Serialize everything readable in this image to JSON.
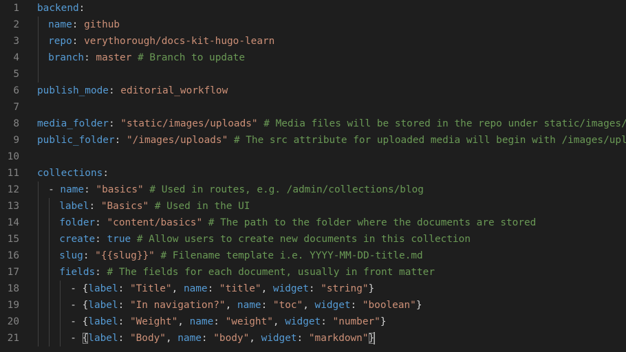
{
  "editor": {
    "lines": [
      {
        "n": "1",
        "indent": 0,
        "guides": [],
        "tokens": [
          {
            "t": "key",
            "v": "backend"
          },
          {
            "t": "pun",
            "v": ":"
          }
        ]
      },
      {
        "n": "2",
        "indent": 2,
        "guides": [
          0
        ],
        "tokens": [
          {
            "t": "key",
            "v": "name"
          },
          {
            "t": "pun",
            "v": ": "
          },
          {
            "t": "str",
            "v": "github"
          }
        ]
      },
      {
        "n": "3",
        "indent": 2,
        "guides": [
          0
        ],
        "tokens": [
          {
            "t": "key",
            "v": "repo"
          },
          {
            "t": "pun",
            "v": ": "
          },
          {
            "t": "str",
            "v": "verythorough/docs-kit-hugo-learn"
          }
        ]
      },
      {
        "n": "4",
        "indent": 2,
        "guides": [
          0
        ],
        "tokens": [
          {
            "t": "key",
            "v": "branch"
          },
          {
            "t": "pun",
            "v": ": "
          },
          {
            "t": "str",
            "v": "master"
          },
          {
            "t": "pun",
            "v": " "
          },
          {
            "t": "com",
            "v": "# Branch to update"
          }
        ]
      },
      {
        "n": "5",
        "indent": 0,
        "guides": [
          0
        ],
        "tokens": []
      },
      {
        "n": "6",
        "indent": 0,
        "guides": [],
        "tokens": [
          {
            "t": "key",
            "v": "publish_mode"
          },
          {
            "t": "pun",
            "v": ": "
          },
          {
            "t": "str",
            "v": "editorial_workflow"
          }
        ]
      },
      {
        "n": "7",
        "indent": 0,
        "guides": [],
        "tokens": []
      },
      {
        "n": "8",
        "indent": 0,
        "guides": [],
        "tokens": [
          {
            "t": "key",
            "v": "media_folder"
          },
          {
            "t": "pun",
            "v": ": "
          },
          {
            "t": "str",
            "v": "\"static/images/uploads\""
          },
          {
            "t": "pun",
            "v": " "
          },
          {
            "t": "com",
            "v": "# Media files will be stored in the repo under static/images/uploads"
          }
        ]
      },
      {
        "n": "9",
        "indent": 0,
        "guides": [],
        "tokens": [
          {
            "t": "key",
            "v": "public_folder"
          },
          {
            "t": "pun",
            "v": ": "
          },
          {
            "t": "str",
            "v": "\"/images/uploads\""
          },
          {
            "t": "pun",
            "v": " "
          },
          {
            "t": "com",
            "v": "# The src attribute for uploaded media will begin with /images/uploads"
          }
        ]
      },
      {
        "n": "10",
        "indent": 0,
        "guides": [],
        "tokens": []
      },
      {
        "n": "11",
        "indent": 0,
        "guides": [],
        "tokens": [
          {
            "t": "key",
            "v": "collections"
          },
          {
            "t": "pun",
            "v": ":"
          }
        ]
      },
      {
        "n": "12",
        "indent": 2,
        "guides": [
          0
        ],
        "tokens": [
          {
            "t": "pun",
            "v": "- "
          },
          {
            "t": "key",
            "v": "name"
          },
          {
            "t": "pun",
            "v": ": "
          },
          {
            "t": "str",
            "v": "\"basics\""
          },
          {
            "t": "pun",
            "v": " "
          },
          {
            "t": "com",
            "v": "# Used in routes, e.g. /admin/collections/blog"
          }
        ]
      },
      {
        "n": "13",
        "indent": 4,
        "guides": [
          0,
          2
        ],
        "tokens": [
          {
            "t": "key",
            "v": "label"
          },
          {
            "t": "pun",
            "v": ": "
          },
          {
            "t": "str",
            "v": "\"Basics\""
          },
          {
            "t": "pun",
            "v": " "
          },
          {
            "t": "com",
            "v": "# Used in the UI"
          }
        ]
      },
      {
        "n": "14",
        "indent": 4,
        "guides": [
          0,
          2
        ],
        "tokens": [
          {
            "t": "key",
            "v": "folder"
          },
          {
            "t": "pun",
            "v": ": "
          },
          {
            "t": "str",
            "v": "\"content/basics\""
          },
          {
            "t": "pun",
            "v": " "
          },
          {
            "t": "com",
            "v": "# The path to the folder where the documents are stored"
          }
        ]
      },
      {
        "n": "15",
        "indent": 4,
        "guides": [
          0,
          2
        ],
        "tokens": [
          {
            "t": "key",
            "v": "create"
          },
          {
            "t": "pun",
            "v": ": "
          },
          {
            "t": "bool",
            "v": "true"
          },
          {
            "t": "pun",
            "v": " "
          },
          {
            "t": "com",
            "v": "# Allow users to create new documents in this collection"
          }
        ]
      },
      {
        "n": "16",
        "indent": 4,
        "guides": [
          0,
          2
        ],
        "tokens": [
          {
            "t": "key",
            "v": "slug"
          },
          {
            "t": "pun",
            "v": ": "
          },
          {
            "t": "str",
            "v": "\"{{slug}}\""
          },
          {
            "t": "pun",
            "v": " "
          },
          {
            "t": "com",
            "v": "# Filename template i.e. YYYY-MM-DD-title.md"
          }
        ]
      },
      {
        "n": "17",
        "indent": 4,
        "guides": [
          0,
          2
        ],
        "tokens": [
          {
            "t": "key",
            "v": "fields"
          },
          {
            "t": "pun",
            "v": ": "
          },
          {
            "t": "com",
            "v": "# The fields for each document, usually in front matter"
          }
        ]
      },
      {
        "n": "18",
        "indent": 6,
        "guides": [
          0,
          2,
          4
        ],
        "tokens": [
          {
            "t": "pun",
            "v": "- {"
          },
          {
            "t": "key",
            "v": "label"
          },
          {
            "t": "pun",
            "v": ": "
          },
          {
            "t": "str",
            "v": "\"Title\""
          },
          {
            "t": "pun",
            "v": ", "
          },
          {
            "t": "key",
            "v": "name"
          },
          {
            "t": "pun",
            "v": ": "
          },
          {
            "t": "str",
            "v": "\"title\""
          },
          {
            "t": "pun",
            "v": ", "
          },
          {
            "t": "key",
            "v": "widget"
          },
          {
            "t": "pun",
            "v": ": "
          },
          {
            "t": "str",
            "v": "\"string\""
          },
          {
            "t": "pun",
            "v": "}"
          }
        ]
      },
      {
        "n": "19",
        "indent": 6,
        "guides": [
          0,
          2,
          4
        ],
        "tokens": [
          {
            "t": "pun",
            "v": "- {"
          },
          {
            "t": "key",
            "v": "label"
          },
          {
            "t": "pun",
            "v": ": "
          },
          {
            "t": "str",
            "v": "\"In navigation?\""
          },
          {
            "t": "pun",
            "v": ", "
          },
          {
            "t": "key",
            "v": "name"
          },
          {
            "t": "pun",
            "v": ": "
          },
          {
            "t": "str",
            "v": "\"toc\""
          },
          {
            "t": "pun",
            "v": ", "
          },
          {
            "t": "key",
            "v": "widget"
          },
          {
            "t": "pun",
            "v": ": "
          },
          {
            "t": "str",
            "v": "\"boolean\""
          },
          {
            "t": "pun",
            "v": "}"
          }
        ]
      },
      {
        "n": "20",
        "indent": 6,
        "guides": [
          0,
          2,
          4
        ],
        "tokens": [
          {
            "t": "pun",
            "v": "- {"
          },
          {
            "t": "key",
            "v": "label"
          },
          {
            "t": "pun",
            "v": ": "
          },
          {
            "t": "str",
            "v": "\"Weight\""
          },
          {
            "t": "pun",
            "v": ", "
          },
          {
            "t": "key",
            "v": "name"
          },
          {
            "t": "pun",
            "v": ": "
          },
          {
            "t": "str",
            "v": "\"weight\""
          },
          {
            "t": "pun",
            "v": ", "
          },
          {
            "t": "key",
            "v": "widget"
          },
          {
            "t": "pun",
            "v": ": "
          },
          {
            "t": "str",
            "v": "\"number\""
          },
          {
            "t": "pun",
            "v": "}"
          }
        ]
      },
      {
        "n": "21",
        "indent": 6,
        "guides": [
          0,
          2,
          4
        ],
        "tokens": [
          {
            "t": "pun",
            "v": "- "
          },
          {
            "t": "pun",
            "v": "{",
            "hl": true
          },
          {
            "t": "key",
            "v": "label"
          },
          {
            "t": "pun",
            "v": ": "
          },
          {
            "t": "str",
            "v": "\"Body\""
          },
          {
            "t": "pun",
            "v": ", "
          },
          {
            "t": "key",
            "v": "name"
          },
          {
            "t": "pun",
            "v": ": "
          },
          {
            "t": "str",
            "v": "\"body\""
          },
          {
            "t": "pun",
            "v": ", "
          },
          {
            "t": "key",
            "v": "widget"
          },
          {
            "t": "pun",
            "v": ": "
          },
          {
            "t": "str",
            "v": "\"markdown\""
          },
          {
            "t": "pun",
            "v": "}",
            "hl": true
          },
          {
            "t": "cursor",
            "v": ""
          }
        ]
      }
    ]
  },
  "colors": {
    "background": "#1e1e1e",
    "line_number": "#858585",
    "key": "#569cd6",
    "string": "#ce9178",
    "comment": "#6a9955",
    "punctuation": "#d4d4d4"
  }
}
